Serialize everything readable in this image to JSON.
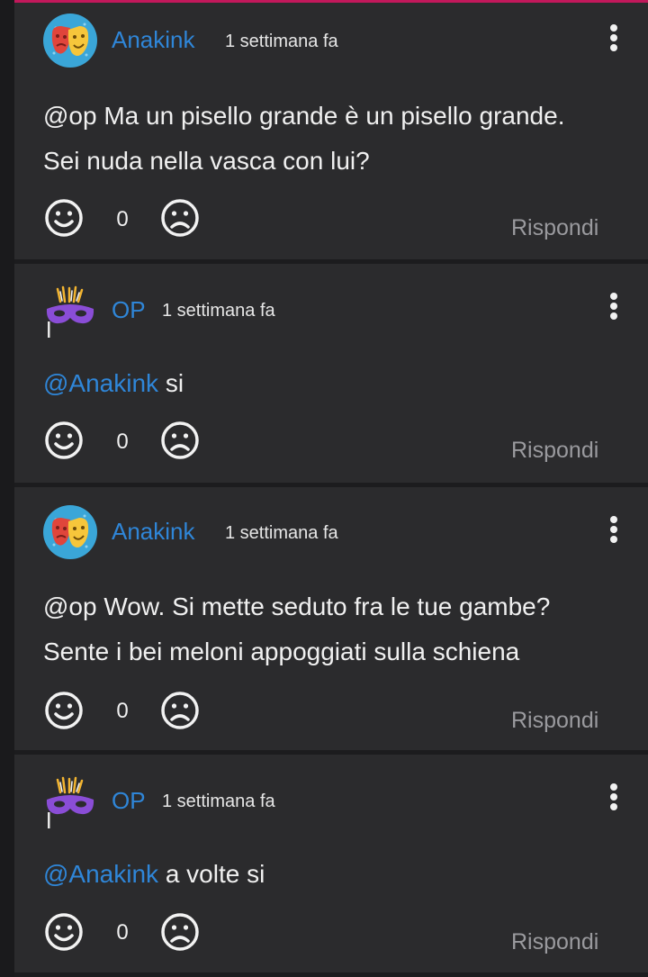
{
  "comments": [
    {
      "author": "Anakink",
      "avatar": "theater-masks-icon",
      "time": "1 settimana fa",
      "mention": "",
      "text_line1": "@op Ma un pisello grande è un pisello grande.",
      "text_line2": "Sei nuda nella vasca con lui?",
      "text_rest": "",
      "count": "0",
      "reply_label": "Rispondi"
    },
    {
      "author": "OP",
      "avatar": "carnival-mask-icon",
      "time": "1 settimana fa",
      "mention": "@Anakink",
      "text_rest": " si",
      "count": "0",
      "reply_label": "Rispondi"
    },
    {
      "author": "Anakink",
      "avatar": "theater-masks-icon",
      "time": "1 settimana fa",
      "mention": "",
      "text_line1": "@op Wow. Si mette seduto fra le tue gambe?",
      "text_line2": "Sente i bei meloni appoggiati sulla schiena",
      "text_rest": "",
      "count": "0",
      "reply_label": "Rispondi"
    },
    {
      "author": "OP",
      "avatar": "carnival-mask-icon",
      "time": "1 settimana fa",
      "mention": "@Anakink",
      "text_rest": " a volte si",
      "count": "0",
      "reply_label": "Rispondi"
    }
  ],
  "colors": {
    "background": "#1c1c1e",
    "card": "#2b2b2d",
    "accent": "#2f86d8",
    "top_bar": "#c2185b",
    "muted": "#9a9a9e"
  }
}
